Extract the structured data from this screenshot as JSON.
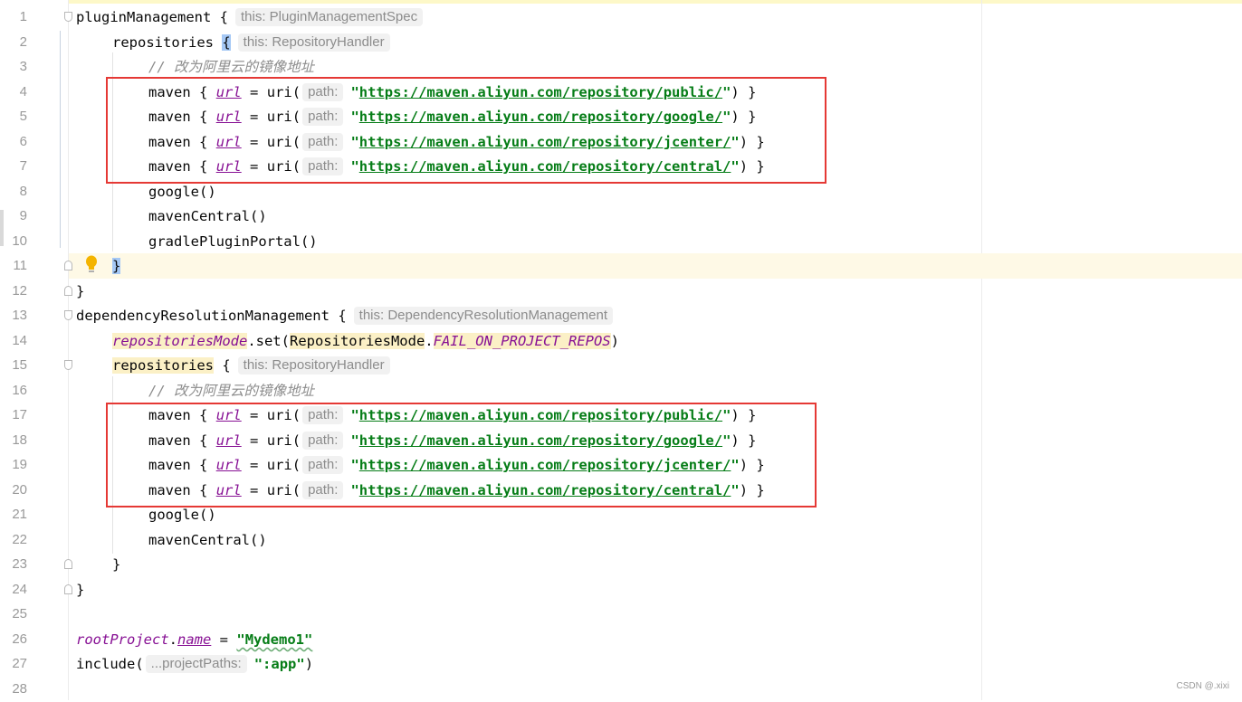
{
  "editor": {
    "lines": [
      {
        "n": "1"
      },
      {
        "n": "2"
      },
      {
        "n": "3"
      },
      {
        "n": "4"
      },
      {
        "n": "5"
      },
      {
        "n": "6"
      },
      {
        "n": "7"
      },
      {
        "n": "8"
      },
      {
        "n": "9"
      },
      {
        "n": "10"
      },
      {
        "n": "11"
      },
      {
        "n": "12"
      },
      {
        "n": "13"
      },
      {
        "n": "14"
      },
      {
        "n": "15"
      },
      {
        "n": "16"
      },
      {
        "n": "17"
      },
      {
        "n": "18"
      },
      {
        "n": "19"
      },
      {
        "n": "20"
      },
      {
        "n": "21"
      },
      {
        "n": "22"
      },
      {
        "n": "23"
      },
      {
        "n": "24"
      },
      {
        "n": "25"
      },
      {
        "n": "26"
      },
      {
        "n": "27"
      },
      {
        "n": "28"
      }
    ],
    "tokens": {
      "plugin_management": "pluginManagement",
      "open_brace": "{",
      "close_brace": "}",
      "hint_plugin_spec": "this: PluginManagementSpec",
      "repositories": "repositories",
      "hint_repo_handler": "this: RepositoryHandler",
      "comment": "// 改为阿里云的镜像地址",
      "maven": "maven",
      "url": "url",
      "eq": "=",
      "uri_open": "uri(",
      "hint_path": "path:",
      "q": "\"",
      "close_paren_brace": ") }",
      "url_public": "https://maven.aliyun.com/repository/public/",
      "url_google": "https://maven.aliyun.com/repository/google/",
      "url_jcenter": "https://maven.aliyun.com/repository/jcenter/",
      "url_central": "https://maven.aliyun.com/repository/central/",
      "google": "google()",
      "maven_central": "mavenCentral()",
      "gradle_plugin_portal": "gradlePluginPortal()",
      "dep_res_mgmt": "dependencyResolutionManagement",
      "hint_dep_res": "this: DependencyResolutionManagement",
      "repositories_mode": "repositoriesMode",
      "set_open": ".set(",
      "repositories_mode_class": "RepositoriesMode",
      "dot": ".",
      "fail_on_project_repos": "FAIL_ON_PROJECT_REPOS",
      "close_paren": ")",
      "root_project": "rootProject",
      "name": "name",
      "mydemo1": "\"Mydemo1\"",
      "include_open": "include(",
      "hint_project_paths": "...projectPaths:",
      "app": "\":app\""
    }
  },
  "watermark": "CSDN @.xixi",
  "colors": {
    "string": "#067d17",
    "property": "#871094",
    "comment": "#8c8c8c",
    "highlight_box": "#e53935",
    "caret_row": "#fef9e6"
  },
  "icons": {
    "intention_bulb": "lightbulb-icon",
    "fold_marker": "fold-marker-icon"
  }
}
